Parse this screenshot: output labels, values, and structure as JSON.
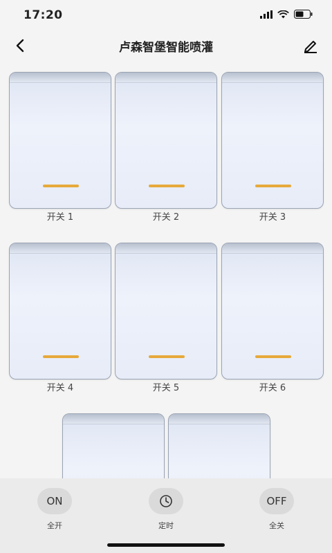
{
  "status": {
    "time": "17:20"
  },
  "nav": {
    "title": "卢森智堡智能喷灌"
  },
  "switches": [
    {
      "label": "开关 1"
    },
    {
      "label": "开关 2"
    },
    {
      "label": "开关 3"
    },
    {
      "label": "开关 4"
    },
    {
      "label": "开关 5"
    },
    {
      "label": "开关 6"
    }
  ],
  "bottom": {
    "all_on": {
      "icon_text": "ON",
      "label": "全开"
    },
    "timer": {
      "label": "定时",
      "icon": "clock-icon"
    },
    "all_off": {
      "icon_text": "OFF",
      "label": "全关"
    }
  },
  "colors": {
    "indicator": "#e7a93a",
    "background": "#f4f4f4"
  }
}
